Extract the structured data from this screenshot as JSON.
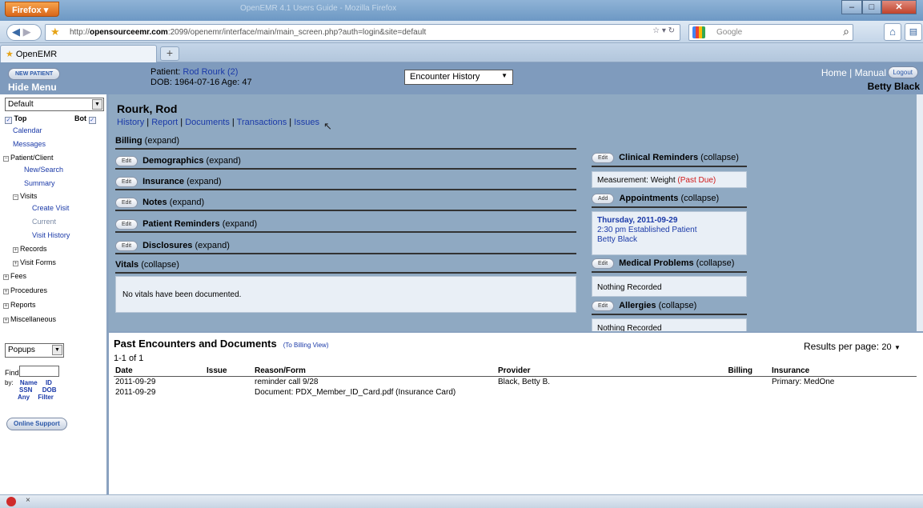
{
  "browser": {
    "firefox_label": "Firefox",
    "window_title": "OpenEMR 4.1 Users Guide - Mozilla Firefox",
    "url_host": "opensourceemr.com",
    "url_prefix": "http://",
    "url_suffix": ":2099/openemr/interface/main/main_screen.php?auth=login&site=default",
    "search_placeholder": "Google",
    "tab_title": "OpenEMR",
    "newtab_label": "+"
  },
  "header": {
    "new_patient": "NEW PATIENT",
    "hide_menu": "Hide Menu",
    "patient_prefix": "Patient:",
    "patient_name": "Rod Rourk (2)",
    "dob_line": "DOB: 1964-07-16 Age: 47",
    "encounter_select": "Encounter History",
    "home": "Home",
    "sep": "|",
    "manual": "Manual",
    "logout": "Logout",
    "user": "Betty Black"
  },
  "nav": {
    "select": "Default",
    "top": "Top",
    "bot": "Bot",
    "items": [
      "Calendar",
      "Messages",
      "Patient/Client",
      "New/Search",
      "Summary",
      "Visits",
      "Create Visit",
      "Current",
      "Visit History",
      "Records",
      "Visit Forms",
      "Fees",
      "Procedures",
      "Reports",
      "Miscellaneous"
    ],
    "popups": "Popups",
    "find": "Find:",
    "by": "by:",
    "by_name": "Name",
    "by_id": "ID",
    "by_ssn": "SSN",
    "by_dob": "DOB",
    "by_any": "Any",
    "by_filter": "Filter",
    "online_support": "Online Support"
  },
  "summary": {
    "name": "Rourk, Rod",
    "links": [
      "History",
      "Report",
      "Documents",
      "Transactions",
      "Issues"
    ],
    "billing": "Billing",
    "expand": "(expand)",
    "collapse": "(collapse)",
    "edit": "Edit",
    "add": "Add",
    "sections": [
      "Demographics",
      "Insurance",
      "Notes",
      "Patient Reminders",
      "Disclosures"
    ],
    "vitals": "Vitals",
    "vitals_text": "No vitals have been documented.",
    "clinical_reminders": "Clinical Reminders",
    "measurement": "Measurement: Weight",
    "past_due": "(Past Due)",
    "appointments": "Appointments",
    "appt_date": "Thursday, 2011-09-29",
    "appt_time": "2:30 pm Established Patient",
    "appt_provider": "Betty Black",
    "medical_problems": "Medical Problems",
    "nothing_recorded": "Nothing Recorded",
    "allergies": "Allergies"
  },
  "encounters": {
    "title": "Past Encounters and Documents",
    "billing_view": "(To Billing View)",
    "count": "1-1 of 1",
    "results_label": "Results per page:",
    "results_value": "20",
    "columns": [
      "Date",
      "Issue",
      "Reason/Form",
      "Provider",
      "Billing",
      "Insurance"
    ],
    "rows": [
      [
        "2011-09-29",
        "",
        "reminder call 9/28",
        "Black, Betty B.",
        "",
        "Primary: MedOne"
      ],
      [
        "2011-09-29",
        "",
        "Document: PDX_Member_ID_Card.pdf (Insurance Card)",
        "",
        "",
        ""
      ]
    ]
  },
  "status": {
    "close": "×"
  },
  "colors": {
    "header_bg": "#7f9bbd",
    "panel_bg": "#8fa9c2",
    "link": "#1b3aa8",
    "past_due": "#d01a1a"
  }
}
